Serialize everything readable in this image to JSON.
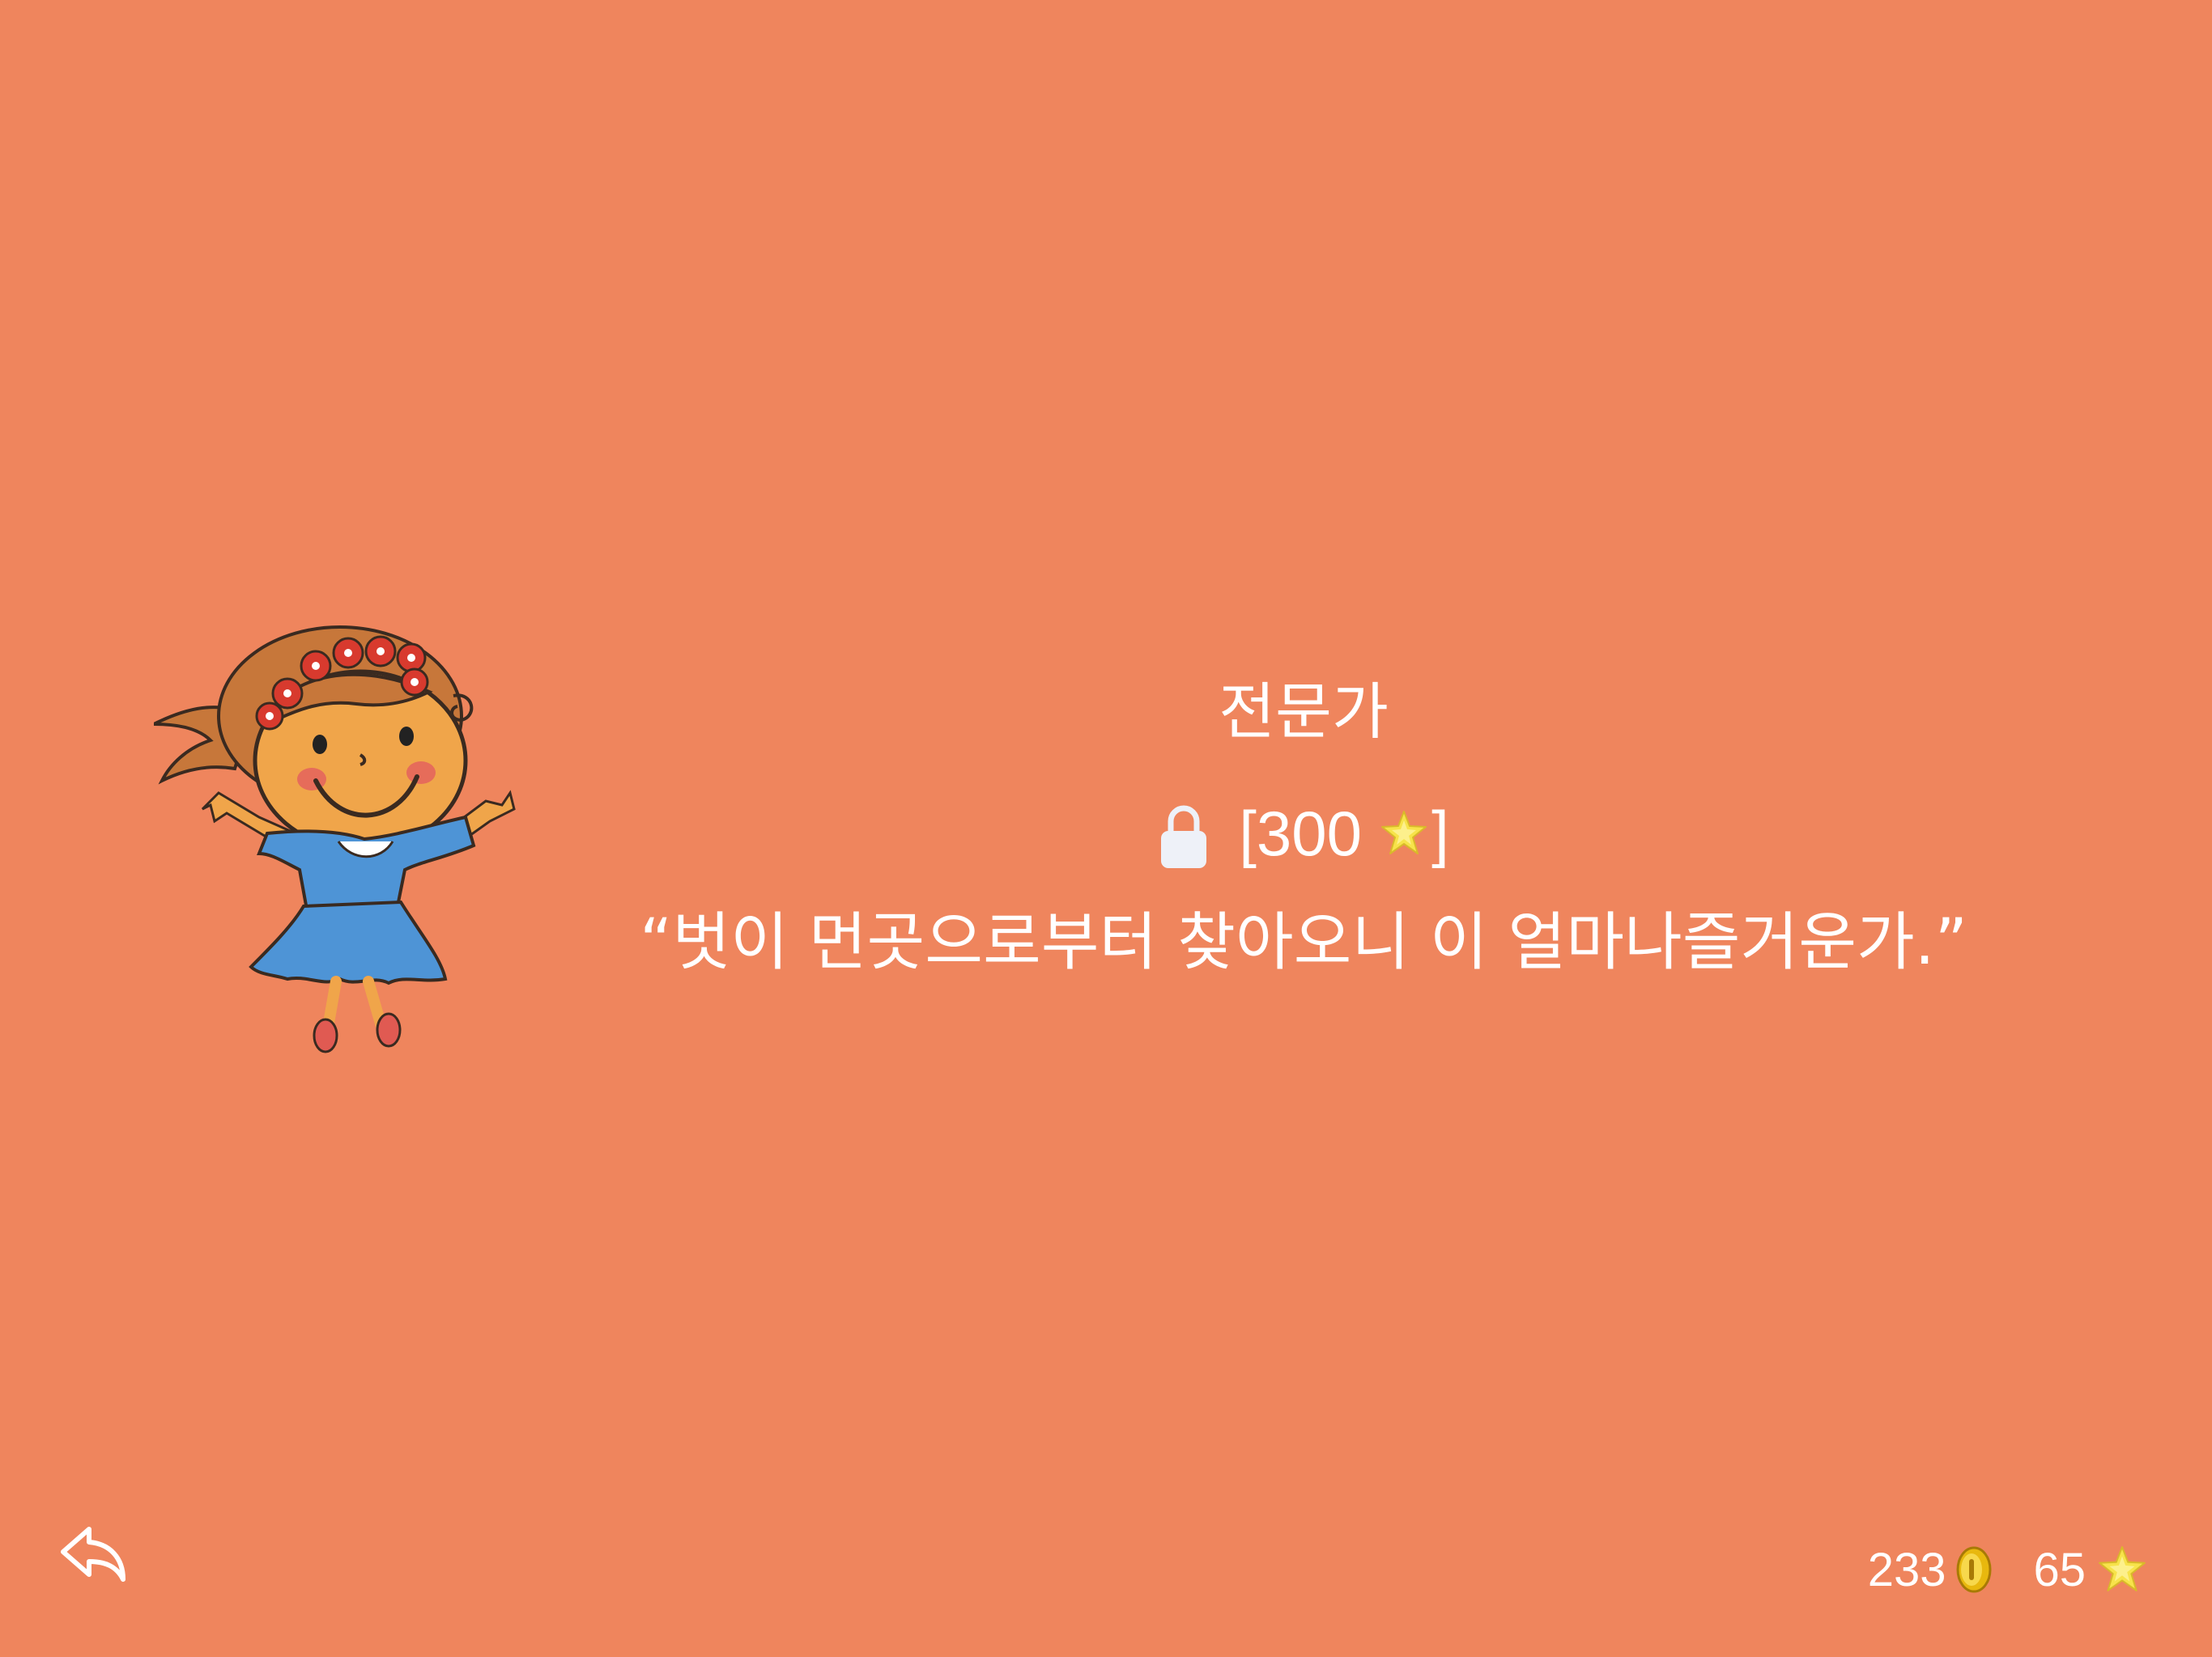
{
  "level": {
    "title": "전문가",
    "unlock_bracket_open": "[",
    "unlock_cost": "300",
    "unlock_bracket_close": "]",
    "unlock_currency_icon": "star-icon",
    "lock_icon": "lock-icon",
    "quote": "“벗이 먼곳으로부터 찾아오니 이 얼마나즐거운가.”"
  },
  "footer": {
    "back_icon": "reply-arrow-icon",
    "coins": "233",
    "coin_icon": "coin-icon",
    "stars": "65",
    "star_icon": "star-icon"
  },
  "colors": {
    "background": "#EF855D",
    "text": "#FFFFFF",
    "star": "#F7E34A",
    "coin": "#E8B80E"
  }
}
